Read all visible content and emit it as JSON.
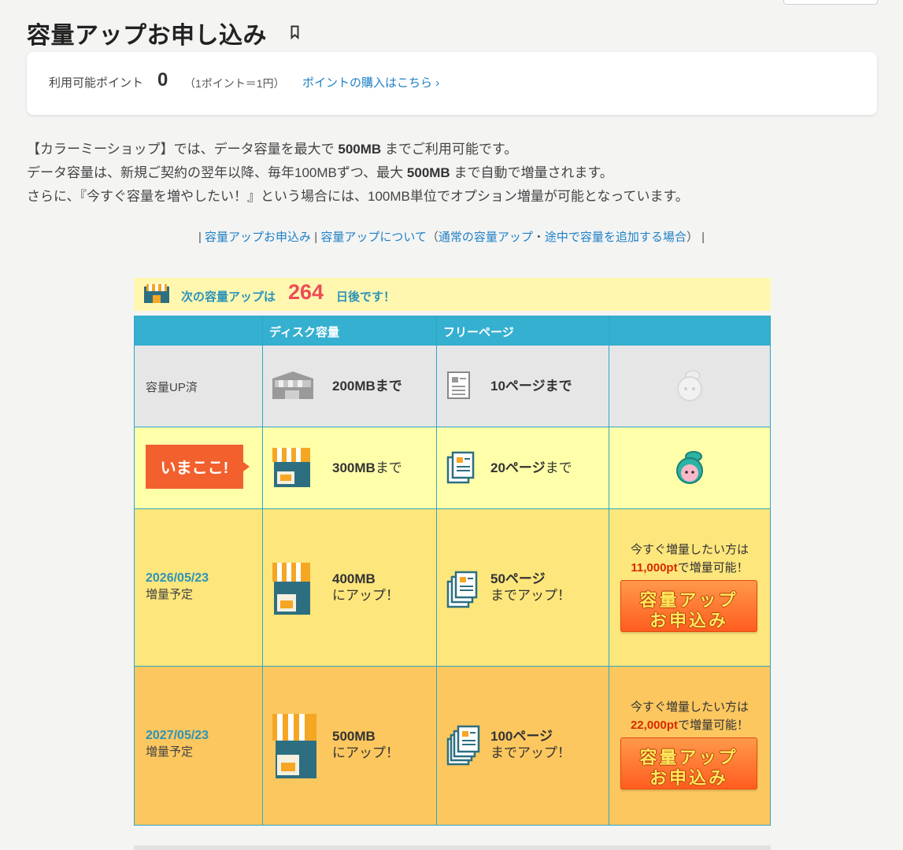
{
  "page": {
    "title": "容量アップお申し込み"
  },
  "points": {
    "label": "利用可能ポイント",
    "value": "0",
    "rate": "（1ポイント＝1円）",
    "buy_link": "ポイントの購入はこちら",
    "buy_arrow": "›"
  },
  "intro": {
    "line1_a": "【カラーミーショップ】では、データ容量を最大で ",
    "line1_b": "500MB",
    "line1_c": " までご利用可能です。",
    "line2_a": "データ容量は、新規ご契約の翌年以降、毎年100MBずつ、最大 ",
    "line2_b": "500MB",
    "line2_c": " まで自動で増量されます。",
    "line3": "さらに、『今すぐ容量を増やしたい！』という場合には、100MB単位でオプション増量が可能となっています。"
  },
  "nav": {
    "sep1": "|",
    "link1": "容量アップお申込み",
    "sep2": "|",
    "link2": "容量アップについて",
    "paren_open": "（",
    "link3": "通常の容量アップ",
    "dot": "・",
    "link4": "途中で容量を追加する場合",
    "paren_close": "）",
    "sep3": "|"
  },
  "banner": {
    "text_before": "次の容量アップは",
    "days": "264",
    "text_after": "日後です！"
  },
  "table": {
    "headers": [
      "",
      "ディスク容量",
      "フリーページ",
      ""
    ],
    "row1": {
      "label": "容量UP済",
      "disk": "200MBまで",
      "pages": "10ページまで"
    },
    "row2": {
      "badge": "いまここ!",
      "disk_a": "300MB",
      "disk_b": "まで",
      "pages_a": "20ページ",
      "pages_b": "まで"
    },
    "row3": {
      "date": "2026/05/23",
      "plan": "増量予定",
      "disk_a": "400MB",
      "disk_b": "にアップ！",
      "pages_a": "50ページ",
      "pages_b": "までアップ！",
      "cta_line1": "今すぐ増量したい方は",
      "cta_pt": "11,000pt",
      "cta_line2": "で増量可能！",
      "btn_l1": "容量アップ",
      "btn_l2": "お申込み"
    },
    "row4": {
      "date": "2027/05/23",
      "plan": "増量予定",
      "disk_a": "500MB",
      "disk_b": "にアップ！",
      "pages_a": "100ページ",
      "pages_b": "までアップ！",
      "cta_line1": "今すぐ増量したい方は",
      "cta_pt": "22,000pt",
      "cta_line2": "で増量可能！",
      "btn_l1": "容量アップ",
      "btn_l2": "お申込み"
    }
  },
  "colors": {
    "link": "#1f80c6",
    "accent_blue": "#36b0d1",
    "days_red": "#ec4b58",
    "row_done": "#e6e6e6",
    "row_now": "#ffffaa",
    "row_next": "#fde67b",
    "row_future": "#fcc75f",
    "cta_orange": "#ff5c1f"
  },
  "icons": {
    "bookmark": "bookmark-icon",
    "store_200": "store-gray-icon",
    "store_300": "store-small-icon",
    "store_400": "store-medium-icon",
    "store_500": "store-large-icon",
    "page": "document-icon",
    "mascot": "mascot-icon"
  }
}
